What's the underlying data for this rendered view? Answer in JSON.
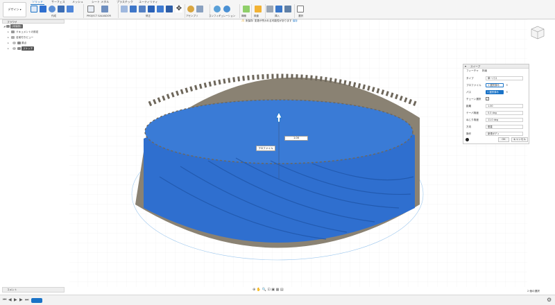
{
  "ribbon": {
    "design_label": "デザイン",
    "tabs": [
      "ソリッド",
      "サーフェス",
      "メッシュ",
      "シート メタル",
      "プラスチック",
      "ユーティリティ"
    ],
    "groups": [
      "作成",
      "PROJECT SALVADOR",
      "修正",
      "アセンブリ",
      "コンフィギュレーション",
      "構築",
      "検査",
      "挿入",
      "選択"
    ]
  },
  "warning": {
    "label": "未保存:",
    "message": "変更が失われる可能性があります",
    "action": "保存"
  },
  "browser": {
    "title": "ブラウザ",
    "items": [
      {
        "label": "(未保存)",
        "kind": "root"
      },
      {
        "label": "ドキュメントの設定",
        "kind": "settings"
      },
      {
        "label": "名前付きビュー",
        "kind": "views"
      },
      {
        "label": "原点",
        "kind": "origin"
      },
      {
        "label": "スケッチ",
        "kind": "sketch"
      }
    ]
  },
  "sweep": {
    "title": "スイープ",
    "tabs": [
      "フィーチャ",
      "拘束"
    ],
    "rows": [
      {
        "label": "タイプ",
        "value": "単一パス"
      },
      {
        "label": "プロファイル",
        "value": "1 選択済み"
      },
      {
        "label": "パス",
        "value": "1 選択済み"
      },
      {
        "label": "チェーン選択",
        "value": "✓"
      },
      {
        "label": "距離",
        "value": "1.00"
      },
      {
        "label": "テーパ角度",
        "value": "0.0 deg"
      },
      {
        "label": "ねじり角度",
        "value": "11.0 deg"
      },
      {
        "label": "方向",
        "value": "垂直"
      },
      {
        "label": "操作",
        "value": "新規ボディ"
      }
    ],
    "ok_label": "OK",
    "cancel_label": "キャンセル"
  },
  "viewport": {
    "profile_label": "プロファイル",
    "distance_value": "1.00",
    "colors": {
      "body": "#2f6fcf",
      "gear": "#8a8273",
      "accent": "#1a73c7"
    }
  },
  "footer": {
    "comment_label": "コメント",
    "selection_count": "2 個の選択"
  }
}
